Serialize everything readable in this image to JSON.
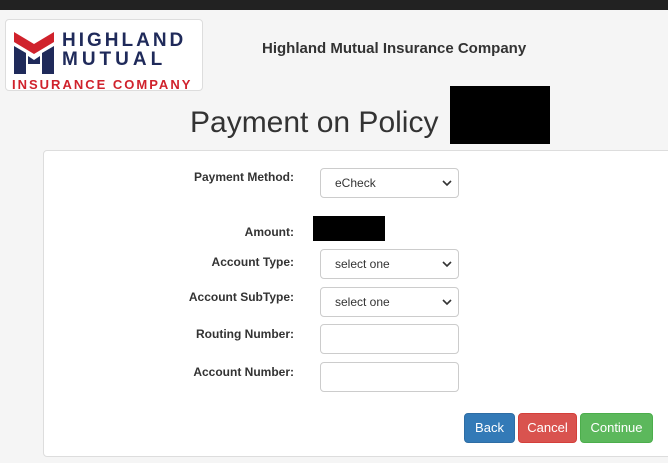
{
  "logo": {
    "line1": "HIGHLAND",
    "line2": "MUTUAL",
    "line3": "INSURANCE COMPANY"
  },
  "header": {
    "company_name": "Highland Mutual Insurance Company"
  },
  "page": {
    "title": "Payment on Policy"
  },
  "form": {
    "payment_method": {
      "label": "Payment Method:",
      "value": "eCheck"
    },
    "amount": {
      "label": "Amount:"
    },
    "account_type": {
      "label": "Account Type:",
      "value": "select one"
    },
    "account_subtype": {
      "label": "Account SubType:",
      "value": "select one"
    },
    "routing_number": {
      "label": "Routing Number:",
      "value": ""
    },
    "account_number": {
      "label": "Account Number:",
      "value": ""
    }
  },
  "buttons": {
    "back": "Back",
    "cancel": "Cancel",
    "continue": "Continue"
  },
  "colors": {
    "primary": "#337ab7",
    "danger": "#d9534f",
    "success": "#5cb85c",
    "brand_navy": "#1f2a5a",
    "brand_red": "#d0222c"
  }
}
